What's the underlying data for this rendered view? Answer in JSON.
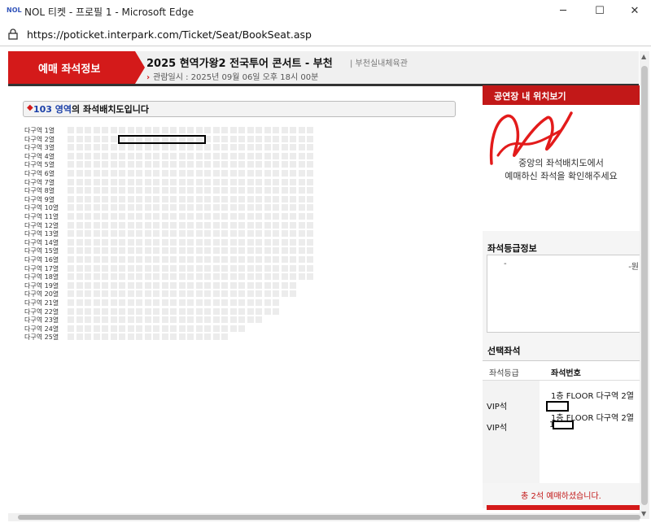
{
  "window": {
    "favicon_text": "NOL",
    "title": "NOL 티켓 - 프로필 1 - Microsoft Edge",
    "minimize": "─",
    "maximize": "☐",
    "close": "✕"
  },
  "address": {
    "url": "https://poticket.interpark.com/Ticket/Seat/BookSeat.asp"
  },
  "header": {
    "badge": "예매 좌석정보",
    "concert": "2025 현역가왕2 전국투어 콘서트 - 부천",
    "venue": "| 부천실내체육관",
    "datetime_arrow": "›",
    "datetime": "관람일시 : 2025년 09월 06일 오후 18시 00분"
  },
  "section": {
    "bullet": "◆",
    "area_name": "103 영역",
    "suffix": "의 좌석배치도입니다"
  },
  "seat_map": {
    "rows": [
      {
        "label": "다구역 1열",
        "seats": 29
      },
      {
        "label": "다구역 2열",
        "seats": 29
      },
      {
        "label": "다구역 3열",
        "seats": 29
      },
      {
        "label": "다구역 4열",
        "seats": 29
      },
      {
        "label": "다구역 5열",
        "seats": 29
      },
      {
        "label": "다구역 6열",
        "seats": 29
      },
      {
        "label": "다구역 7열",
        "seats": 29
      },
      {
        "label": "다구역 8열",
        "seats": 29
      },
      {
        "label": "다구역 9열",
        "seats": 29
      },
      {
        "label": "다구역 10열",
        "seats": 29
      },
      {
        "label": "다구역 11열",
        "seats": 29
      },
      {
        "label": "다구역 12열",
        "seats": 29
      },
      {
        "label": "다구역 13열",
        "seats": 29
      },
      {
        "label": "다구역 14열",
        "seats": 29
      },
      {
        "label": "다구역 15열",
        "seats": 29
      },
      {
        "label": "다구역 16열",
        "seats": 29
      },
      {
        "label": "다구역 17열",
        "seats": 29
      },
      {
        "label": "다구역 18열",
        "seats": 29
      },
      {
        "label": "다구역 19열",
        "seats": 27
      },
      {
        "label": "다구역 20열",
        "seats": 27
      },
      {
        "label": "다구역 21열",
        "seats": 25
      },
      {
        "label": "다구역 22열",
        "seats": 25
      },
      {
        "label": "다구역 23열",
        "seats": 23
      },
      {
        "label": "다구역 24열",
        "seats": 21
      },
      {
        "label": "다구역 25열",
        "seats": 19
      }
    ]
  },
  "right_panel": {
    "location_button": "공연장 내 위치보기",
    "map_message_1": "중앙의 좌석배치도에서",
    "map_message_2": "예매하신 좌석을 확인해주세요",
    "grade_title": "좌석등급정보",
    "grade_name": "-",
    "grade_price": "-원",
    "selected_title": "선택좌석",
    "col_grade": "좌석등급",
    "col_seat": "좌석번호",
    "selected": [
      {
        "grade": "VIP석",
        "seat": "1층 FLOOR 다구역 2열"
      },
      {
        "grade": "VIP석",
        "seat": "1층 FLOOR 다구역 2열"
      }
    ],
    "seat2_prefix": "1",
    "total": "총 2석 예매하셨습니다."
  },
  "colors": {
    "accent_red": "#d41a1a",
    "seat_gray": "#ececec",
    "area_blue": "#1a3fa8"
  }
}
